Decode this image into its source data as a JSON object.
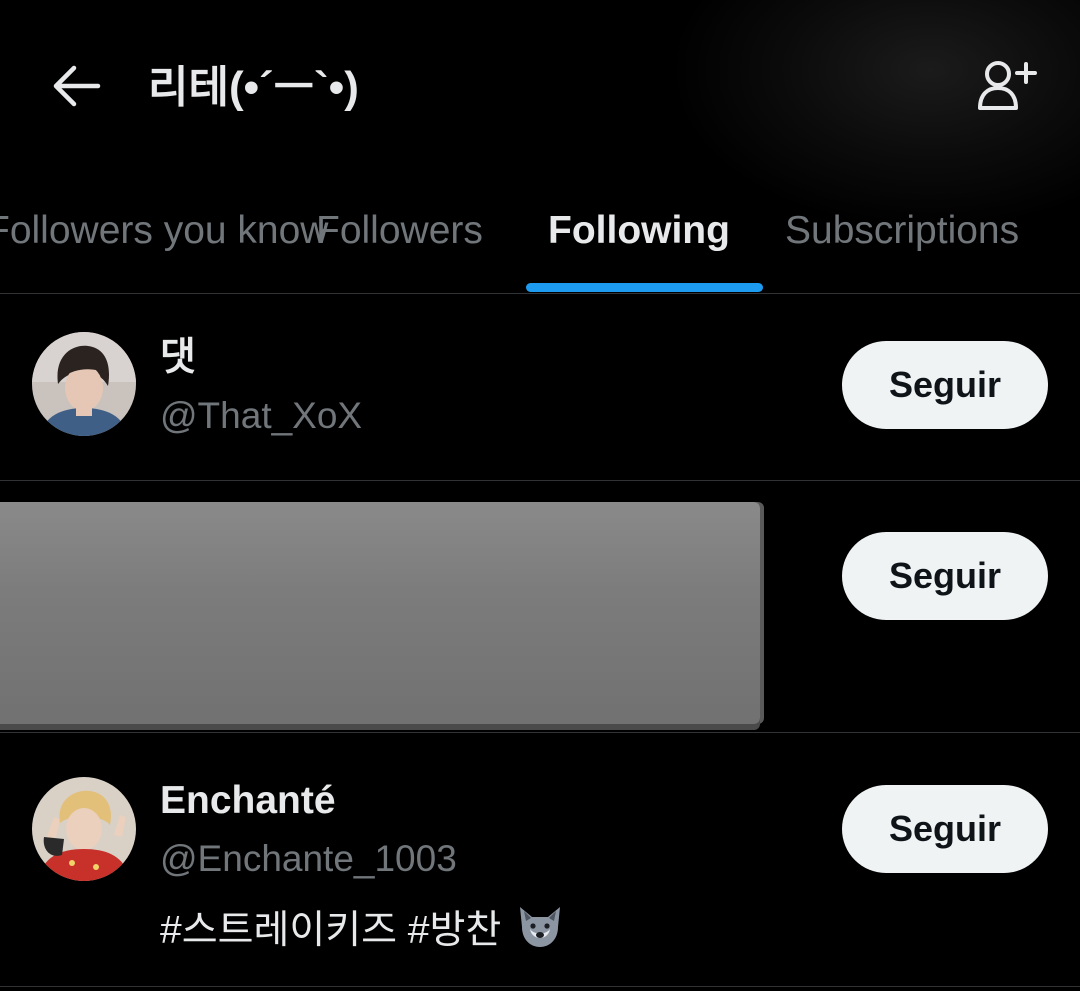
{
  "header": {
    "title": "리테(•´ㅡ`•)",
    "back_icon": "arrow-left-icon",
    "add_user_icon": "person-add-icon"
  },
  "tabs": [
    {
      "label": "Followers you know",
      "active": false
    },
    {
      "label": "Followers",
      "active": false
    },
    {
      "label": "Following",
      "active": true
    },
    {
      "label": "Subscriptions",
      "active": false
    }
  ],
  "accent_color": "#1d9bf0",
  "users": [
    {
      "display_name": "댓",
      "handle": "@That_XoX",
      "follow_label": "Seguir"
    },
    {
      "display_name": "",
      "handle": "",
      "follow_label": "Seguir",
      "redacted": true
    },
    {
      "display_name": "Enchanté",
      "handle": "@Enchante_1003",
      "bio": "#스트레이키즈 #방찬",
      "bio_emoji": "wolf-face-icon",
      "follow_label": "Seguir"
    }
  ]
}
